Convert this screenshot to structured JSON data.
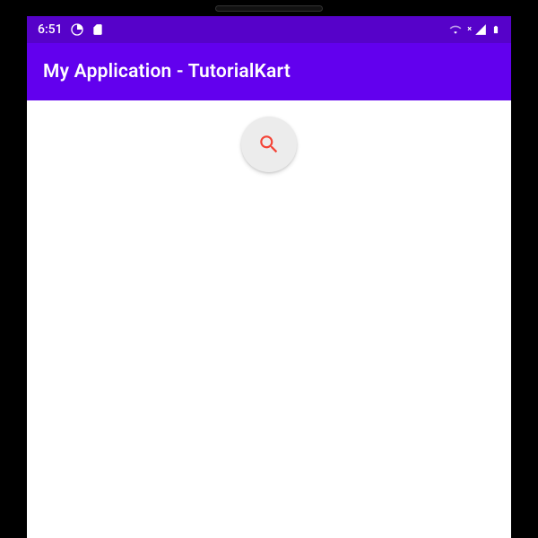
{
  "status_bar": {
    "time": "6:51",
    "icons_left": {
      "data_saver": "data-saver-icon",
      "sd": "sd-card-icon"
    },
    "icons_right": {
      "wifi": "wifi-icon",
      "signal": "signal-icon",
      "battery": "battery-icon"
    }
  },
  "app_bar": {
    "title": "My Application - TutorialKart"
  },
  "content": {
    "fab": {
      "icon": "search-icon",
      "icon_color": "#f44336",
      "background": "#ececec"
    }
  },
  "colors": {
    "primary": "#6200EE",
    "primary_dark": "#5602c9"
  }
}
